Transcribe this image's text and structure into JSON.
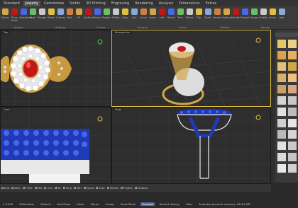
{
  "menu": {
    "tabs": [
      "Standard",
      "Jewelry",
      "Gemstones",
      "Solids",
      "3D Printing",
      "Engraving",
      "Rendering",
      "Analysis",
      "Dimensions",
      "Extras"
    ]
  },
  "ribbon": {
    "buttons": [
      "Shank",
      "Ring Head",
      "Gemstone",
      "Pavé",
      "Prongs",
      "Bezel",
      "Cutters",
      "Text",
      "Fit",
      "Surface",
      "Points",
      "Rotate",
      "Offset",
      "Copy",
      "Cap",
      "Curve",
      "Array",
      "Loft",
      "Blend",
      "Trim",
      "Mirror",
      "Flip",
      "Gems",
      "Heads",
      "Setting",
      "Modify",
      "Project",
      "Gauge",
      "Profile",
      "Scale",
      "Join"
    ],
    "groups": [
      "Jewelry",
      "Settings",
      "Curves",
      "Surface",
      "Solids",
      "Utilities",
      "Render"
    ]
  },
  "viewports": {
    "top": "Top",
    "perspective": "Perspective",
    "front": "Front",
    "right": "Right"
  },
  "colors": {
    "gold": "#d4a64a",
    "ruby": "#c01818",
    "blue": "#1f3ab8",
    "white": "#f2f2f2",
    "active": "#e0c040"
  },
  "status_checks": [
    "End",
    "Near",
    "Point",
    "Mid",
    "Cen",
    "Int",
    "Perp",
    "Tan",
    "Quad",
    "Knot",
    "Vertex",
    "Project",
    "Disable"
  ],
  "status_bottom": [
    "x 0.000",
    "Millimeters",
    "Default",
    "Grid Snap",
    "Ortho",
    "Planar",
    "Osnap",
    "SmartTrack",
    "Gumball",
    "Record History",
    "Filter",
    "Available physical memory: 16294 MB"
  ]
}
